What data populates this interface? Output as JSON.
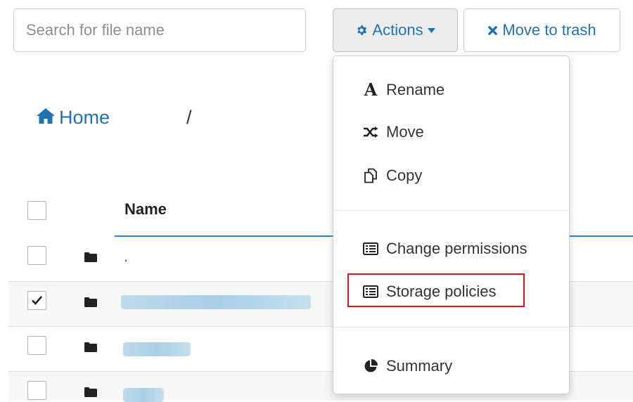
{
  "search": {
    "placeholder": "Search for file name"
  },
  "toolbar": {
    "actions_label": "Actions",
    "trash_label": "Move to trash"
  },
  "breadcrumb": {
    "home_label": "Home",
    "separator": "/"
  },
  "table": {
    "header_name": "Name",
    "rows": [
      {
        "name": ".",
        "checked": false
      },
      {
        "name": "",
        "checked": true
      },
      {
        "name": "",
        "checked": false
      },
      {
        "name": "",
        "checked": false
      }
    ]
  },
  "actions_menu": {
    "items": [
      {
        "label": "Rename",
        "icon": "font-icon"
      },
      {
        "label": "Move",
        "icon": "random-icon"
      },
      {
        "label": "Copy",
        "icon": "copy-icon"
      },
      {
        "label": "Change permissions",
        "icon": "list-alt-icon"
      },
      {
        "label": "Storage policies",
        "icon": "list-alt-icon",
        "highlighted": true
      },
      {
        "label": "Summary",
        "icon": "pie-chart-icon"
      }
    ]
  },
  "colors": {
    "link": "#2271b1",
    "highlight_box": "#e01020",
    "header_underline": "#2a82c6"
  }
}
